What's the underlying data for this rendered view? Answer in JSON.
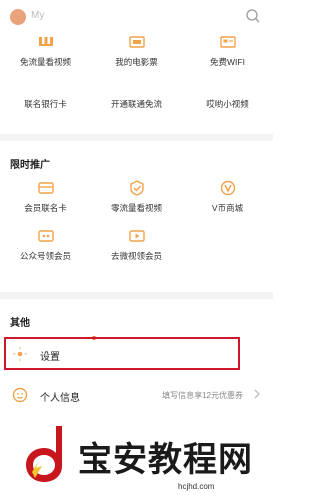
{
  "header": {
    "username": "My",
    "search_icon": "search-icon"
  },
  "services": [
    {
      "label": "免流量看视频",
      "icon": "video-free-icon"
    },
    {
      "label": "我的电影票",
      "icon": "movie-ticket-icon"
    },
    {
      "label": "免费WIFI",
      "icon": "wifi-icon"
    },
    {
      "label": "联名银行卡",
      "icon": "bank-card-icon"
    },
    {
      "label": "开通联通免流",
      "icon": "unicom-free-icon"
    },
    {
      "label": "哎哟小视频",
      "icon": "short-video-icon"
    }
  ],
  "promo": {
    "title": "限时推广",
    "items": [
      {
        "label": "会员联名卡",
        "icon": "member-card-icon"
      },
      {
        "label": "零流量看视频",
        "icon": "zero-data-icon"
      },
      {
        "label": "V币商城",
        "icon": "vcoin-icon"
      },
      {
        "label": "公众号领会员",
        "icon": "official-account-icon"
      },
      {
        "label": "去微视领会员",
        "icon": "weishi-icon"
      }
    ]
  },
  "other": {
    "title": "其他",
    "settings_label": "设置",
    "profile_label": "个人信息",
    "profile_hint": "填写信息享12元优惠券"
  },
  "watermark": {
    "text": "宝安教程网",
    "url": "hcjhd.com"
  },
  "colors": {
    "accent": "#f2a24a",
    "highlight": "#d0162b"
  }
}
